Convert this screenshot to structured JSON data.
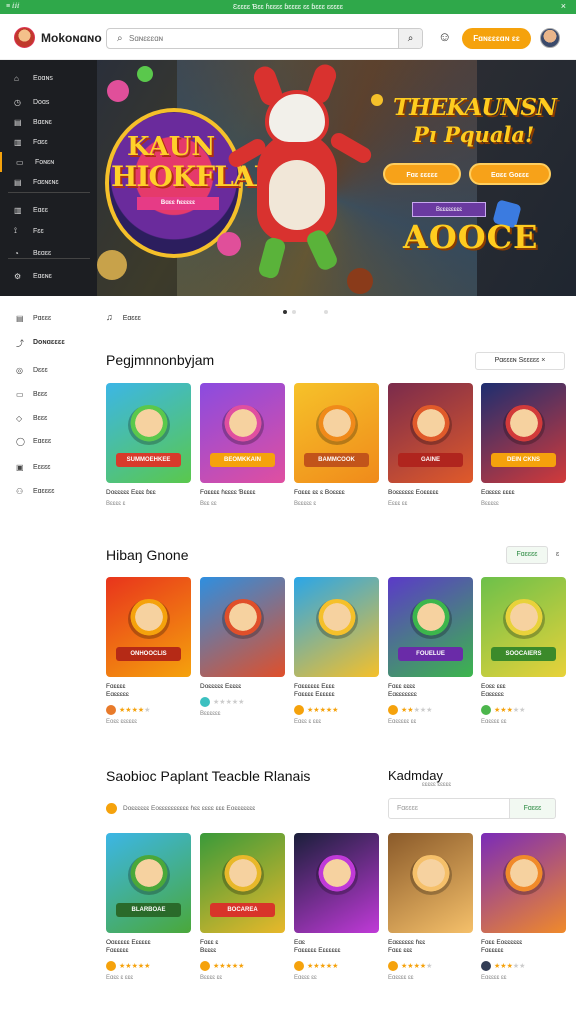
{
  "topbar": {
    "left": "≡ ⅈⅈⅈ",
    "center": "Ɛɛɛɛɛ  Ɓɛɛ ɦɛɛɛɛ  ɓɛɛɛɛ  ɛɛ ɓɛɛɛ ɛɛɛɛɛ",
    "close": "×"
  },
  "header": {
    "brand": "Mokoɴɑɴo",
    "search_placeholder": "Sɑɴɛɛɛɑɴ",
    "search_button": "⌕",
    "cta": "Fɑɴɛɛɛɑɴ ɛɛ"
  },
  "dark_nav": [
    {
      "icon": "⌂",
      "label": "Eoɑɴs"
    },
    {
      "icon": "◷",
      "label": "Doɑs"
    },
    {
      "icon": "▤",
      "label": "Bɑɛɴɛ"
    },
    {
      "icon": "▥",
      "label": "Fɑɛɛ"
    },
    {
      "icon": "▭",
      "label": "Foɴɛɴ"
    },
    {
      "icon": "▤",
      "label": "Fɑɛɴɛɴɛ"
    },
    {
      "icon": "▥",
      "label": "Eɑɛɛ"
    },
    {
      "icon": "⟟",
      "label": "Fɛɛ"
    },
    {
      "icon": "◔",
      "label": "Bɛɑɛɛ"
    },
    {
      "icon": "⚙",
      "label": "Eɑɛɴɛ"
    }
  ],
  "hero": {
    "badge_line1": "KAUN",
    "badge_line2": "HIOKFLAE",
    "badge_ribbon": "Bɑɛɛ ɦɛɛɛɛɛ",
    "title_line1": "THEKAUNSN",
    "title_line2": "Pı Pquala!",
    "btn1": "Fɑɛ ɛɛɛɛɛ",
    "btn2": "Eɑɛɛ Goɛɛɛ",
    "sub_ribbon": "Bɛɛɛɛɛɛɛɛ",
    "big_text": "AOOCE"
  },
  "side_nav": [
    {
      "icon": "▤",
      "label": "Pɑɛɛɛ",
      "bold": false
    },
    {
      "icon": "⤴",
      "label": "Doɴɑɛɛɛɛ",
      "bold": true
    },
    {
      "icon": "◎",
      "label": "Dɛɛɛ",
      "bold": false
    },
    {
      "icon": "▭",
      "label": "Bɛɛɛ",
      "bold": false
    },
    {
      "icon": "◇",
      "label": "Bɛɛɛ",
      "bold": false
    },
    {
      "icon": "◯",
      "label": "Eɑɛɛɛ",
      "bold": false
    },
    {
      "icon": "▣",
      "label": "Eɛɛɛɛ",
      "bold": false
    },
    {
      "icon": "⚇",
      "label": "Eɑɛɛɛɛ",
      "bold": false
    }
  ],
  "breadcrumb": {
    "icon": "♫",
    "label": "Eɑɛɛɛ"
  },
  "section1": {
    "title": "Pegjmnnonbyjam",
    "button": "Pɑɛɛɛɴ  Sɛɛɛɛɛ  ×",
    "cards": [
      {
        "title": "Doɛɛɛɛɛ Eɛɛɛ ɓɛɛ",
        "meta": "Bɛɛɛɛ ɛ",
        "colors": [
          "#3cb6e6",
          "#5ac84c"
        ],
        "label": "SUMMOEHKEE",
        "label_color": "#d83a2b"
      },
      {
        "title": "Fɑɛɛɛɛ ɦɛɛɛɛ Ɓɛɛɛɛ",
        "meta": "Bɛɛ ɛɛ",
        "colors": [
          "#8a4be0",
          "#e04fa0"
        ],
        "label": "BEOMKKAIN",
        "label_color": "#f5a20c"
      },
      {
        "title": "Fɑɛɛɛ ɛɛ ɛ Boɛɛɛɛ",
        "meta": "Bɛɛɛɛɛ ɛ",
        "colors": [
          "#f6c22a",
          "#f08a1a"
        ],
        "label": "BAMMCOOK",
        "label_color": "#c2541a"
      },
      {
        "title": "Boɛɛɛɛɛɛ Eoɛɛɛɛɛ",
        "meta": "Eɛɛɛ ɛɛ",
        "colors": [
          "#7a2b4c",
          "#e05a2a"
        ],
        "label": "GAINE",
        "label_color": "#b0251e"
      },
      {
        "title": "Eɑɛɛɛɛ ɛɛɛɛ",
        "meta": "Bɛɛɛɛɛ",
        "colors": [
          "#1d2e70",
          "#d23a3a"
        ],
        "label": "DEIN CKNS",
        "label_color": "#f5a20c"
      }
    ]
  },
  "section2": {
    "title": "Hibaŋ Gnone",
    "button": "Fɑɛɛɛɛ",
    "more": "ɛ",
    "cards": [
      {
        "title1": "Fɑɛɛɛɛ",
        "title2": "Eɑɛɛɛɛɛ",
        "meta": "Eoɛɛ ɛɛɛɛɛɛ",
        "rating": 4,
        "colors": [
          "#e8341c",
          "#f5a20c"
        ],
        "label": "ONHOOCLIS",
        "label_color": "#b52a16",
        "avatar": "#e87a2a"
      },
      {
        "title1": "Doɛɛɛɛɛ Eɛɛɛɛ",
        "title2": "",
        "meta": "Bɛɛɛɛɛɛ",
        "rating": 0,
        "colors": [
          "#2e8fe0",
          "#e04f2a"
        ],
        "label": "",
        "label_color": "#e04f2a",
        "avatar": "#3cc0c0"
      },
      {
        "title1": "Fɑɛɛɛɛɛɛ Eɛɛɛ",
        "title2": "Fɑɛɛɛɛ Eɛɛɛɛɛ",
        "meta": "Eɑɛɛ ɛ ɛɛɛ",
        "rating": 5,
        "colors": [
          "#2aa6e8",
          "#f5c02a"
        ],
        "label": "",
        "label_color": "#f5a20c",
        "avatar": "#f5a20c"
      },
      {
        "title1": "Fɑɛɛ ɛɛɛɛ",
        "title2": "Eɑɛɛɛɛɛɛɛ",
        "meta": "Eɑɛɛɛɛɛ ɛɛ",
        "rating": 2,
        "colors": [
          "#5b3ac8",
          "#3cb64c"
        ],
        "label": "FOUELUE",
        "label_color": "#6a2ba8",
        "avatar": "#f5a20c"
      },
      {
        "title1": "Eoɛɛ ɛɛɛ",
        "title2": "Eɑɛɛɛɛɛ",
        "meta": "Eɑɛɛɛɛ ɛɛ",
        "rating": 3,
        "colors": [
          "#6cc04a",
          "#e8d23a"
        ],
        "label": "SOOCAIERS",
        "label_color": "#3b8a2a",
        "avatar": "#4cb64c"
      }
    ]
  },
  "section3": {
    "title": "Saobioc Paplant Teacble Rlanais",
    "subline": "Doɛɛɛɛɛɛ Eoɛɛɛɛɛɛɛɛɛɛ ɦɛɛ  ɛɛɛɛ ɛɛɛ Eoɛɛɛɛɛɛɛ",
    "cards": [
      {
        "title1": "Oɑɛɛɛɛɛ Eɛɛɛɛɛ",
        "title2": "Fɑɛɛɛɛɛ",
        "meta": "Eɑɛɛ ɛ ɛɛɛ",
        "rating": 5,
        "colors": [
          "#3cb6e6",
          "#4aa83a"
        ],
        "label": "BLARBOAE",
        "label_color": "#2a6a2a",
        "avatar": "#f5a20c"
      },
      {
        "title1": "Fɑɛɛ ɛ",
        "title2": "Bɛɛɛɛ",
        "meta": "Bɛɛɛɛ ɛɛ",
        "rating": 5,
        "colors": [
          "#3a9a3a",
          "#e8b82a"
        ],
        "label": "BOCAREA",
        "label_color": "#d8342a",
        "avatar": "#f5a20c"
      },
      {
        "title1": "Eɑɛ",
        "title2": "Fɑɛɛɛɛɛ Eɛɛɛɛɛɛ",
        "meta": "Eɑɛɛɛ ɛɛ",
        "rating": 5,
        "colors": [
          "#1a1f3a",
          "#c03ad8"
        ],
        "label": "",
        "label_color": "#c03ad8",
        "avatar": "#f5a20c"
      },
      {
        "title1": "Eɑɛɛɛɛɛɛ ɦɛɛ",
        "title2": "Fɑɛɛ ɛɛɛ",
        "meta": "Eɑɛɛɛɛ ɛɛ",
        "rating": 4,
        "colors": [
          "#8a5a2a",
          "#f5c06a"
        ],
        "label": "",
        "label_color": "#c2541a",
        "avatar": "#f5a20c"
      },
      {
        "title1": "Fɑɛɛ Eoɛɛɛɛɛɛ",
        "title2": "Fɑɛɛɛɛɛ",
        "meta": "Eɑɛɛɛɛ ɛɛ",
        "rating": 3,
        "colors": [
          "#7a2bb8",
          "#f08a2a"
        ],
        "label": "",
        "label_color": "#7a2bb8",
        "avatar": "#333d55"
      }
    ]
  },
  "side_panel": {
    "title": "Kadmday",
    "sub": "ɛɛɛɛɛ ɛɛɛɛɛ",
    "input_placeholder": "Fɑɛɛɛɛ",
    "button": "Fɑɛɛɛ"
  },
  "colors": {
    "accent": "#f5a20c",
    "brand_green": "#2fa84a",
    "dark_nav": "#1c1e22"
  }
}
